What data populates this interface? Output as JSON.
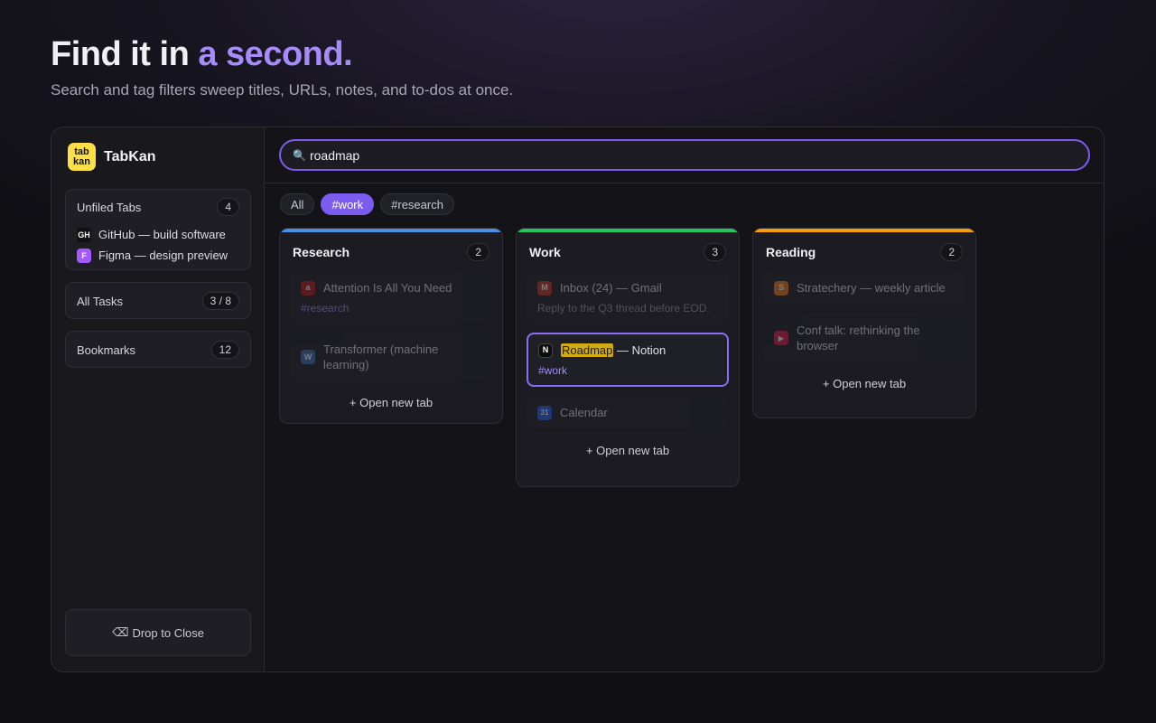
{
  "hero": {
    "title_plain": "Find it in ",
    "title_accent": "a second.",
    "subtitle": "Search and tag filters sweep titles, URLs, notes, and to-dos at once."
  },
  "sidebar": {
    "logo_line1": "tab",
    "logo_line2": "kan",
    "brand": "TabKan",
    "unfiled": {
      "title": "Unfiled Tabs",
      "count": "4",
      "items": [
        {
          "icon": "GH",
          "icon_name": "github-icon",
          "label": "GitHub — build software"
        },
        {
          "icon": "F",
          "icon_name": "figma-icon",
          "label": "Figma — design preview"
        }
      ]
    },
    "tasks": {
      "title": "All Tasks",
      "count": "3 / 8"
    },
    "bookmarks": {
      "title": "Bookmarks",
      "count": "12"
    },
    "drop_icon": "⌫",
    "drop_label": "Drop to Close"
  },
  "search": {
    "icon": "🔍",
    "value": "roadmap"
  },
  "filters": [
    "All",
    "#work",
    "#research"
  ],
  "active_filter": "#work",
  "columns": [
    {
      "title": "Research",
      "count": "2",
      "color": "#4a90e2",
      "cards": [
        {
          "icon": "a",
          "label": "Attention Is All You Need",
          "tag": "#research"
        },
        {
          "icon": "W",
          "label": "Transformer (machine learning)"
        }
      ],
      "open_tab": "+ Open new tab"
    },
    {
      "title": "Work",
      "count": "3",
      "color": "#22c55e",
      "cards": [
        {
          "icon": "M",
          "label": "Inbox (24) — Gmail",
          "note": "Reply to the Q3 thread before EOD."
        },
        {
          "icon": "N",
          "label_highlight": "Roadmap",
          "label_rest": " — Notion",
          "tag": "#work"
        },
        {
          "icon": "31",
          "label": "Calendar"
        }
      ],
      "open_tab": "+ Open new tab"
    },
    {
      "title": "Reading",
      "count": "2",
      "color": "#f59e0b",
      "cards": [
        {
          "icon": "S",
          "label": "Stratechery — weekly article"
        },
        {
          "icon": "▶",
          "label": "Conf talk: rethinking the browser"
        }
      ],
      "open_tab": "+ Open new tab"
    }
  ],
  "colors": {
    "accent": "#a78bfa",
    "search_border": "#7c5cf0",
    "logo": "#fde047",
    "highlight": "#f1c40f"
  }
}
